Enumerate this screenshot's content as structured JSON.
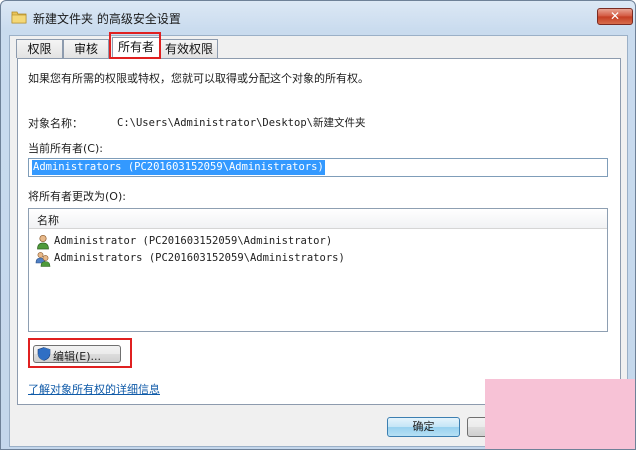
{
  "window": {
    "title": "新建文件夹 的高级安全设置",
    "close_glyph": "✕"
  },
  "tabs": [
    {
      "label": "权限"
    },
    {
      "label": "审核"
    },
    {
      "label": "所有者"
    },
    {
      "label": "有效权限"
    }
  ],
  "owner_page": {
    "intro": "如果您有所需的权限或特权，您就可以取得或分配这个对象的所有权。",
    "object_name_label": "对象名称：",
    "object_name_value": "C:\\Users\\Administrator\\Desktop\\新建文件夹",
    "current_owner_label": "当前所有者(C):",
    "current_owner_value": "Administrators (PC201603152059\\Administrators)",
    "change_owner_label": "将所有者更改为(O):",
    "list_header": "名称",
    "owners": [
      {
        "name": "Administrator (PC201603152059\\Administrator)",
        "icon": "user-icon"
      },
      {
        "name": "Administrators (PC201603152059\\Administrators)",
        "icon": "group-icon"
      }
    ],
    "edit_button": "编辑(E)...",
    "details_link": "了解对象所有权的详细信息"
  },
  "footer": {
    "ok_label": "确定"
  },
  "colors": {
    "highlight_border": "#e02020",
    "selection": "#3399ff",
    "link": "#0f5aa8"
  }
}
